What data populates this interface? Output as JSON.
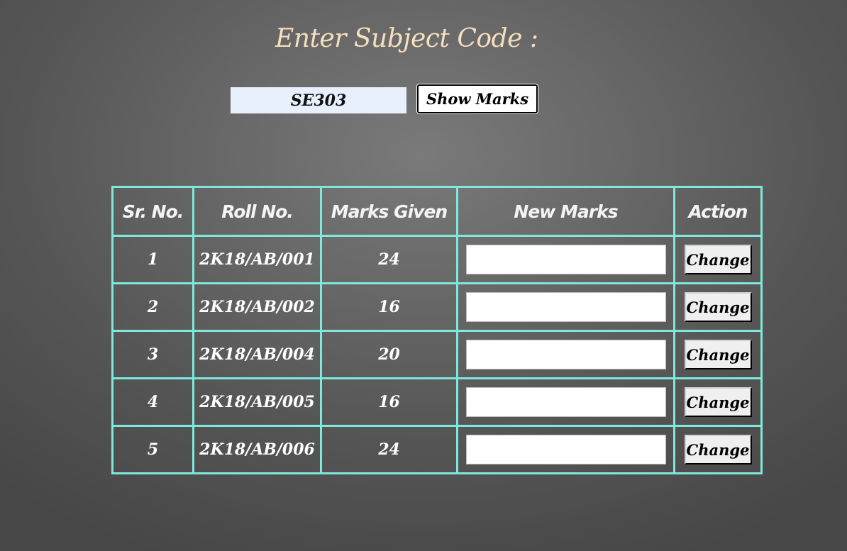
{
  "heading": "Enter Subject Code :",
  "subject_code": {
    "value": "SE303"
  },
  "show_button_label": "Show Marks",
  "table": {
    "headers": {
      "sr_no": "Sr. No.",
      "roll_no": "Roll No.",
      "marks_given": "Marks Given",
      "new_marks": "New Marks",
      "action": "Action"
    },
    "rows": [
      {
        "sr": "1",
        "roll": "2K18/AB/001",
        "marks": "24",
        "new_marks": "",
        "action_label": "Change"
      },
      {
        "sr": "2",
        "roll": "2K18/AB/002",
        "marks": "16",
        "new_marks": "",
        "action_label": "Change"
      },
      {
        "sr": "3",
        "roll": "2K18/AB/004",
        "marks": "20",
        "new_marks": "",
        "action_label": "Change"
      },
      {
        "sr": "4",
        "roll": "2K18/AB/005",
        "marks": "16",
        "new_marks": "",
        "action_label": "Change"
      },
      {
        "sr": "5",
        "roll": "2K18/AB/006",
        "marks": "24",
        "new_marks": "",
        "action_label": "Change"
      }
    ]
  },
  "colors": {
    "heading": "#f6dfbd",
    "table_border": "#7ee8dc",
    "input_background": "#e8f0fe"
  }
}
